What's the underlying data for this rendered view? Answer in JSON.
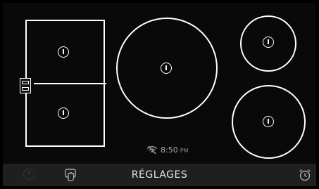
{
  "status": {
    "time": "8:50",
    "ampm": "PM",
    "wifi_icon": "wifi-off-icon"
  },
  "zones": [
    {
      "id": "flex-top-left",
      "power_icon": "power-icon"
    },
    {
      "id": "flex-bottom-left",
      "power_icon": "power-icon"
    },
    {
      "id": "large-center",
      "power_icon": "power-icon"
    },
    {
      "id": "small-top-right",
      "power_icon": "power-icon"
    },
    {
      "id": "medium-bottom-right",
      "power_icon": "power-icon"
    }
  ],
  "bottom_bar": {
    "settings_label": "RÉGLAGES",
    "left_icon": "power-icon",
    "lock_icon": "hand-lock-icon",
    "timer_icon": "alarm-clock-icon"
  },
  "colors": {
    "background": "#090909",
    "zone_outline": "#ffffff",
    "bottom_bar": "#1f1f1f",
    "muted_text": "#9a9a9a"
  }
}
